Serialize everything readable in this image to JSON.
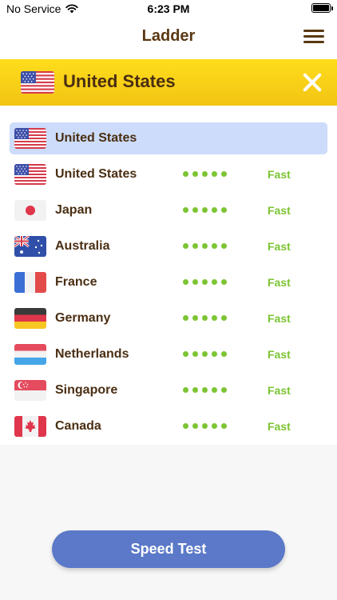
{
  "status_bar": {
    "carrier": "No Service",
    "time": "6:23 PM",
    "icons": [
      "wifi-icon",
      "battery-icon"
    ]
  },
  "nav": {
    "title": "Ladder",
    "menu_icon": "hamburger-menu-icon"
  },
  "selected_server": {
    "country": "United States",
    "flag": "us-flag-icon",
    "close_icon": "close-icon"
  },
  "servers": [
    {
      "country": "United States",
      "flag": "us",
      "signal": "",
      "speed": "",
      "selected": true
    },
    {
      "country": "United States",
      "flag": "us",
      "signal": "●●●●●",
      "speed": "Fast",
      "selected": false
    },
    {
      "country": "Japan",
      "flag": "jp",
      "signal": "●●●●●",
      "speed": "Fast",
      "selected": false
    },
    {
      "country": "Australia",
      "flag": "au",
      "signal": "●●●●●",
      "speed": "Fast",
      "selected": false
    },
    {
      "country": "France",
      "flag": "fr",
      "signal": "●●●●●",
      "speed": "Fast",
      "selected": false
    },
    {
      "country": "Germany",
      "flag": "de",
      "signal": "●●●●●",
      "speed": "Fast",
      "selected": false
    },
    {
      "country": "Netherlands",
      "flag": "nl",
      "signal": "●●●●●",
      "speed": "Fast",
      "selected": false
    },
    {
      "country": "Singapore",
      "flag": "sg",
      "signal": "●●●●●",
      "speed": "Fast",
      "selected": false
    },
    {
      "country": "Canada",
      "flag": "ca",
      "signal": "●●●●●",
      "speed": "Fast",
      "selected": false
    }
  ],
  "speed_test": {
    "label": "Speed Test"
  },
  "colors": {
    "accent_yellow": "#ffd81a",
    "brown_text": "#4a2e12",
    "fast_green": "#7cc433",
    "button_blue": "#5b79c8",
    "selected_row": "#ccdcfa"
  }
}
